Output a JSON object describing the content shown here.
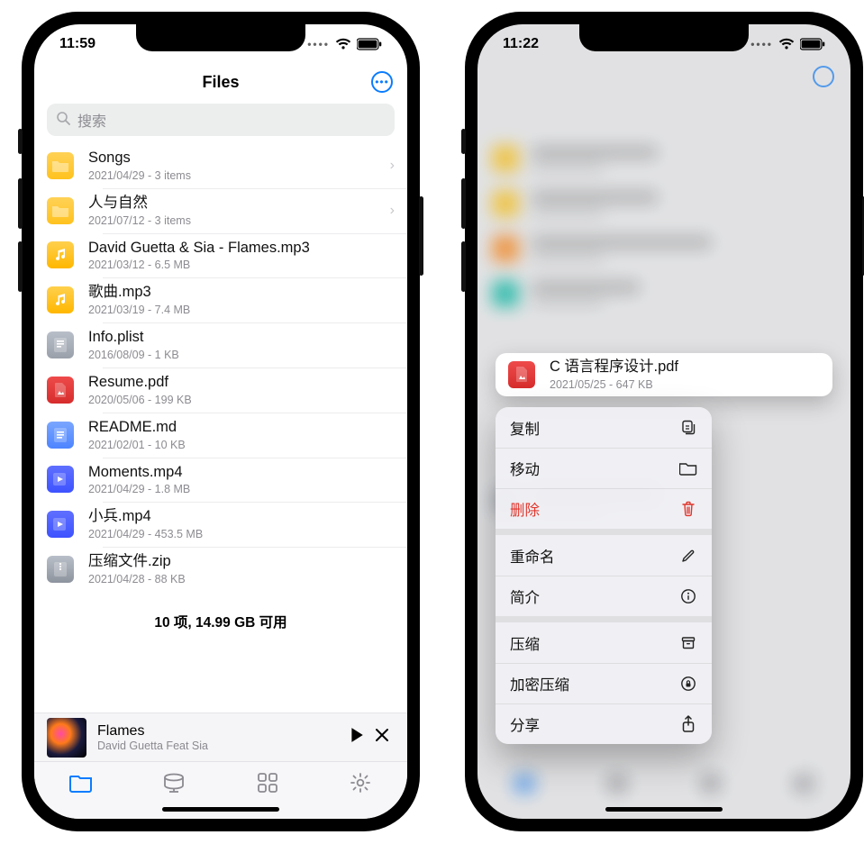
{
  "left": {
    "status": {
      "time": "11:59"
    },
    "header": {
      "title": "Files"
    },
    "search": {
      "placeholder": "搜索"
    },
    "files": [
      {
        "kind": "folder",
        "name": "Songs",
        "sub": "2021/04/29 - 3 items",
        "chevron": true
      },
      {
        "kind": "folder",
        "name": "人与自然",
        "sub": "2021/07/12 - 3 items",
        "chevron": true
      },
      {
        "kind": "mp3",
        "name": "David Guetta & Sia - Flames.mp3",
        "sub": "2021/03/12 - 6.5 MB"
      },
      {
        "kind": "mp3",
        "name": "歌曲.mp3",
        "sub": "2021/03/19 - 7.4 MB"
      },
      {
        "kind": "txt",
        "name": "Info.plist",
        "sub": "2016/08/09 - 1 KB"
      },
      {
        "kind": "pdf",
        "name": "Resume.pdf",
        "sub": "2020/05/06 - 199 KB"
      },
      {
        "kind": "md",
        "name": "README.md",
        "sub": "2021/02/01 - 10 KB"
      },
      {
        "kind": "mp4",
        "name": "Moments.mp4",
        "sub": "2021/04/29 - 1.8 MB"
      },
      {
        "kind": "mp4",
        "name": "小兵.mp4",
        "sub": "2021/04/29 - 453.5 MB"
      },
      {
        "kind": "zip",
        "name": "压缩文件.zip",
        "sub": "2021/04/28 - 88 KB"
      }
    ],
    "summary": "10 项, 14.99 GB 可用",
    "now_playing": {
      "title": "Flames",
      "artist": "David Guetta Feat Sia"
    }
  },
  "right": {
    "status": {
      "time": "11:22"
    },
    "selected_file": {
      "name": "C 语言程序设计.pdf",
      "sub": "2021/05/25 - 647 KB"
    },
    "menu_groups": [
      [
        {
          "label": "复制",
          "icon": "copy-icon",
          "danger": false
        },
        {
          "label": "移动",
          "icon": "folder-icon",
          "danger": false
        },
        {
          "label": "删除",
          "icon": "trash-icon",
          "danger": true
        }
      ],
      [
        {
          "label": "重命名",
          "icon": "pencil-icon",
          "danger": false
        },
        {
          "label": "简介",
          "icon": "info-icon",
          "danger": false
        }
      ],
      [
        {
          "label": "压缩",
          "icon": "archive-icon",
          "danger": false
        },
        {
          "label": "加密压缩",
          "icon": "locked-archive-icon",
          "danger": false
        },
        {
          "label": "分享",
          "icon": "share-icon",
          "danger": false
        }
      ]
    ]
  },
  "icons": {
    "copy-icon": "⧉",
    "folder-icon": "▭",
    "trash-icon": "🗑",
    "pencil-icon": "✎",
    "info-icon": "ⓘ",
    "archive-icon": "☐",
    "locked-archive-icon": "◉",
    "share-icon": "⇧"
  },
  "colors": {
    "accent": "#0a7cff",
    "danger": "#e0352b"
  }
}
